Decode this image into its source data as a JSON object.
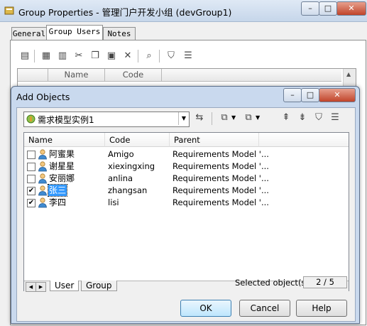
{
  "window": {
    "title": "Group Properties - 管理门户开发小组 (devGroup1)"
  },
  "tabs": [
    {
      "label": "General"
    },
    {
      "label": "Group Users"
    },
    {
      "label": "Notes"
    }
  ],
  "grid": {
    "columns": [
      "Name",
      "Code"
    ]
  },
  "dialog": {
    "title": "Add Objects",
    "model": "需求模型实例1",
    "columns": [
      "Name",
      "Code",
      "Parent"
    ],
    "rows": [
      {
        "name": "阿蜜果",
        "code": "Amigo",
        "parent": "Requirements Model '...",
        "checked": false
      },
      {
        "name": "谢星星",
        "code": "xiexingxing",
        "parent": "Requirements Model '...",
        "checked": false
      },
      {
        "name": "安丽娜",
        "code": "anlina",
        "parent": "Requirements Model '...",
        "checked": false
      },
      {
        "name": "张三",
        "code": "zhangsan",
        "parent": "Requirements Model '...",
        "checked": true
      },
      {
        "name": "李四",
        "code": "lisi",
        "parent": "Requirements Model '...",
        "checked": true
      }
    ],
    "bottom_tabs": [
      {
        "label": "User"
      },
      {
        "label": "Group"
      }
    ],
    "selected_label": "Selected object(s):",
    "selected_value": "2 / 5",
    "buttons": {
      "ok": "OK",
      "cancel": "Cancel",
      "help": "Help"
    }
  },
  "icons": {
    "window": "app-icon",
    "check": "✔",
    "user": "user-icon"
  },
  "colors": {
    "selection": "#3399ff",
    "dialog_frame": "#c9d9ee"
  }
}
